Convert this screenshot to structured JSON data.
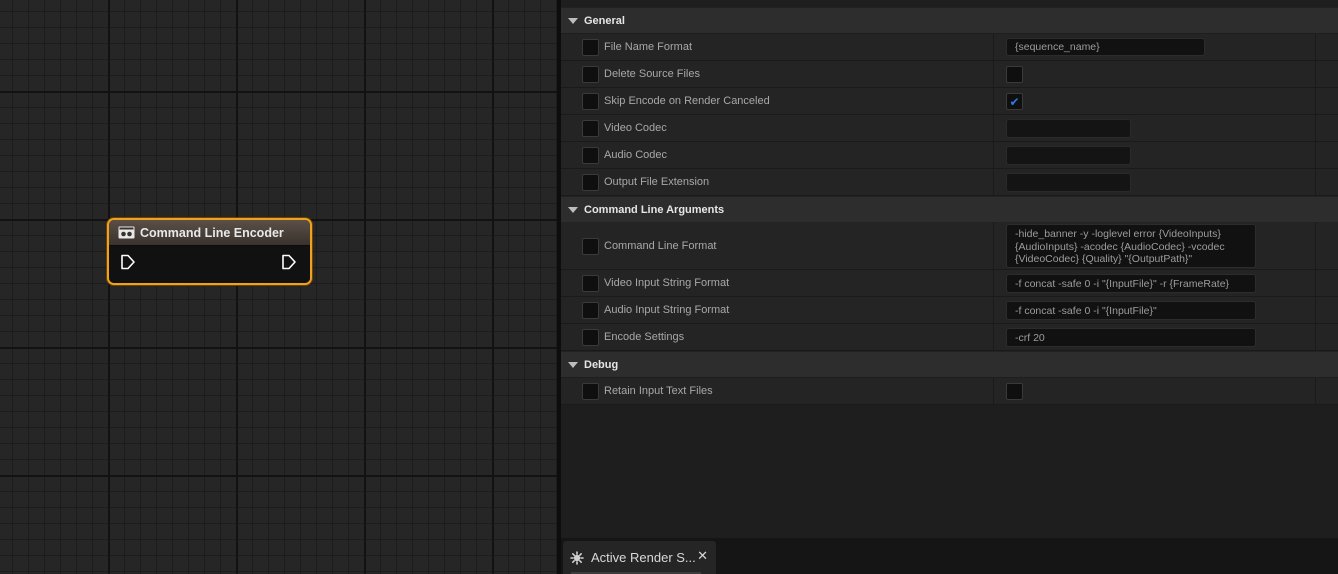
{
  "graph": {
    "node": {
      "title": "Command Line Encoder",
      "icon": "video-camera-icon",
      "input_pin": "exec-pin-icon",
      "output_pin": "exec-pin-icon",
      "accent_color": "#f0a21e"
    }
  },
  "details": {
    "sections": {
      "general": {
        "title": "General",
        "rows": [
          {
            "label": "File Name Format",
            "value": "{sequence_name}"
          },
          {
            "label": "Delete Source Files",
            "checked": false
          },
          {
            "label": "Skip Encode on Render Canceled",
            "checked": true
          },
          {
            "label": "Video Codec",
            "value": ""
          },
          {
            "label": "Audio Codec",
            "value": ""
          },
          {
            "label": "Output File Extension",
            "value": ""
          }
        ]
      },
      "command_line": {
        "title": "Command Line Arguments",
        "rows": [
          {
            "label": "Command Line Format",
            "value": "-hide_banner -y -loglevel error {VideoInputs} {AudioInputs} -acodec {AudioCodec} -vcodec {VideoCodec} {Quality} \"{OutputPath}\""
          },
          {
            "label": "Video Input String Format",
            "value": "-f concat -safe 0 -i \"{InputFile}\" -r {FrameRate}"
          },
          {
            "label": "Audio Input String Format",
            "value": "-f concat -safe 0 -i \"{InputFile}\""
          },
          {
            "label": "Encode Settings",
            "value": "-crf 20"
          }
        ]
      },
      "debug": {
        "title": "Debug",
        "rows": [
          {
            "label": "Retain Input Text Files",
            "checked": false
          }
        ]
      }
    }
  },
  "tabs": [
    {
      "label": "Active Render S...",
      "icon": "render-settings-icon",
      "close": "✕"
    }
  ]
}
